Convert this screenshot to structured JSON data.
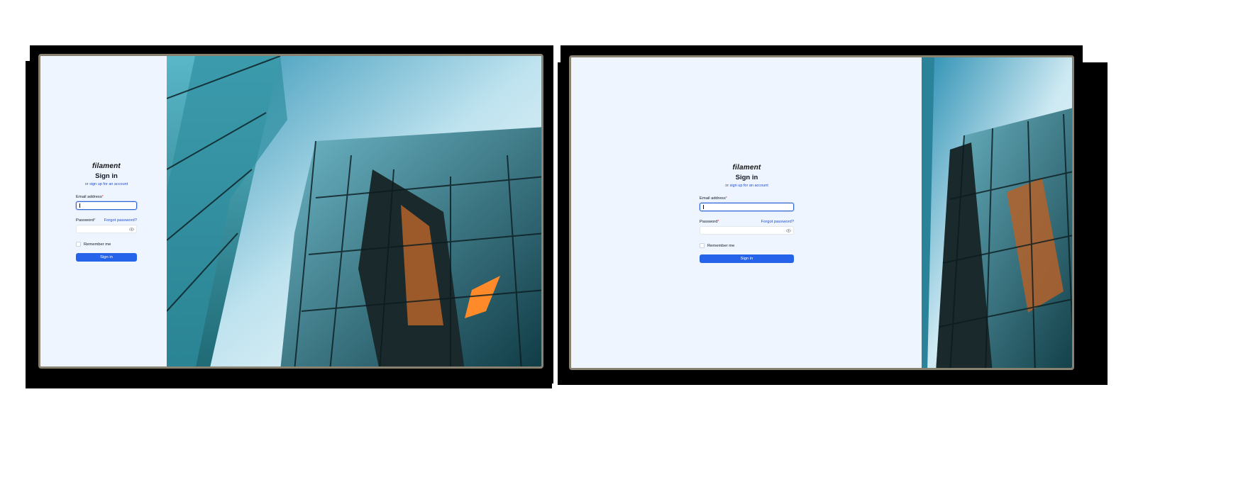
{
  "screens": [
    {
      "name": "sidebar-layout",
      "form": {
        "logo": "filament",
        "title": "Sign in",
        "subline_prefix": "or",
        "signup_link": "sign up for an account",
        "email_label": "Email address",
        "required_mark": "*",
        "password_label": "Password",
        "forgot_link": "Forgot password?",
        "remember_label": "Remember me",
        "submit_label": "Sign in"
      }
    },
    {
      "name": "wide-form-layout",
      "form": {
        "logo": "filament",
        "title": "Sign in",
        "subline_prefix": "or",
        "signup_link": "sign up for an account",
        "email_label": "Email address",
        "required_mark": "*",
        "password_label": "Password",
        "forgot_link": "Forgot password?",
        "remember_label": "Remember me",
        "submit_label": "Sign in"
      }
    }
  ],
  "colors": {
    "panel_background": "#eef5ff",
    "accent": "#2563eb",
    "link": "#1d4ed8",
    "frame": "#8a8270"
  },
  "icons": {
    "password_toggle": "eye-icon"
  }
}
